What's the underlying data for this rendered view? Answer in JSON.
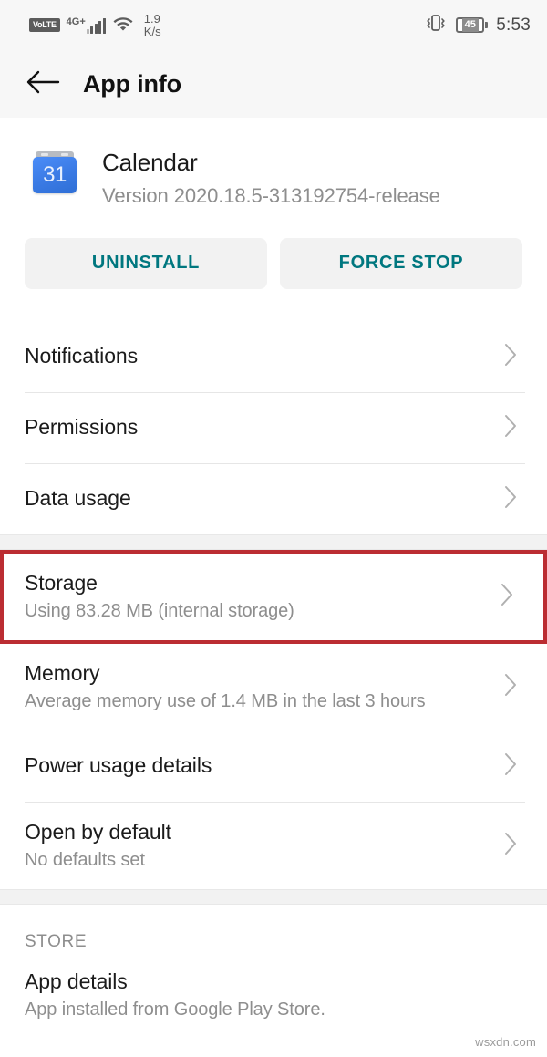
{
  "status_bar": {
    "volte_label": "VoLTE",
    "network_label": "4G+",
    "data_rate_value": "1.9",
    "data_rate_unit": "K/s",
    "battery_level": "45",
    "time": "5:53",
    "icons": {
      "signal": "signal-bars-icon",
      "wifi": "wifi-icon",
      "vibrate": "vibrate-icon",
      "battery": "battery-icon"
    }
  },
  "app_bar": {
    "back_icon": "back-arrow-icon",
    "title": "App info"
  },
  "app": {
    "icon_name": "calendar-app-icon",
    "icon_day_number": "31",
    "name": "Calendar",
    "version": "Version 2020.18.5-313192754-release"
  },
  "actions": {
    "uninstall_label": "UNINSTALL",
    "force_stop_label": "FORCE STOP",
    "accent_color": "#00777f",
    "background_color": "#f2f2f2"
  },
  "settings_rows": [
    {
      "title": "Notifications",
      "subtitle": ""
    },
    {
      "title": "Permissions",
      "subtitle": ""
    },
    {
      "title": "Data usage",
      "subtitle": ""
    },
    {
      "title": "Storage",
      "subtitle": "Using 83.28 MB (internal storage)"
    },
    {
      "title": "Memory",
      "subtitle": "Average memory use of 1.4 MB in the last 3 hours"
    },
    {
      "title": "Power usage details",
      "subtitle": ""
    },
    {
      "title": "Open by default",
      "subtitle": "No defaults set"
    }
  ],
  "highlight": {
    "target_row": "Storage",
    "border_color": "#bb2d32"
  },
  "store_section": {
    "header": "STORE",
    "row": {
      "title": "App details",
      "subtitle": "App installed from Google Play Store."
    }
  },
  "watermark": "wsxdn.com"
}
